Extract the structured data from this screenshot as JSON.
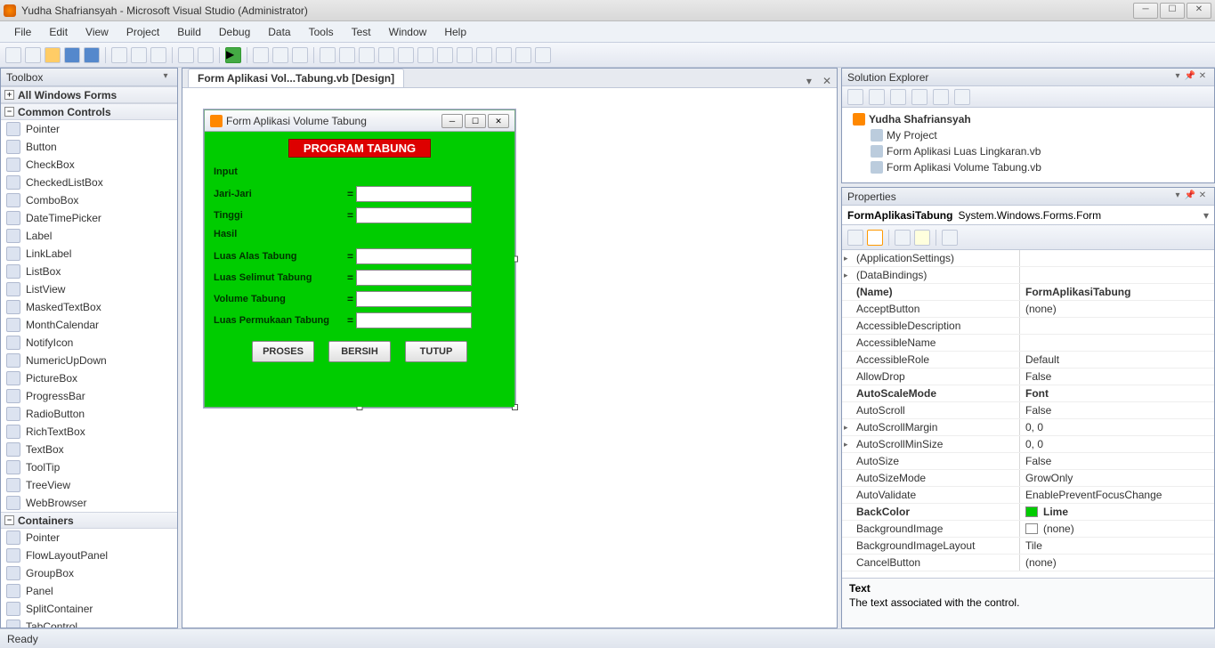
{
  "title": "Yudha Shafriansyah - Microsoft Visual Studio (Administrator)",
  "menu": [
    "File",
    "Edit",
    "View",
    "Project",
    "Build",
    "Debug",
    "Data",
    "Tools",
    "Test",
    "Window",
    "Help"
  ],
  "toolbox": {
    "title": "Toolbox",
    "groups": [
      {
        "label": "All Windows Forms",
        "items": []
      },
      {
        "label": "Common Controls",
        "items": [
          "Pointer",
          "Button",
          "CheckBox",
          "CheckedListBox",
          "ComboBox",
          "DateTimePicker",
          "Label",
          "LinkLabel",
          "ListBox",
          "ListView",
          "MaskedTextBox",
          "MonthCalendar",
          "NotifyIcon",
          "NumericUpDown",
          "PictureBox",
          "ProgressBar",
          "RadioButton",
          "RichTextBox",
          "TextBox",
          "ToolTip",
          "TreeView",
          "WebBrowser"
        ]
      },
      {
        "label": "Containers",
        "items": [
          "Pointer",
          "FlowLayoutPanel",
          "GroupBox",
          "Panel",
          "SplitContainer",
          "TabControl"
        ]
      }
    ]
  },
  "tab": "Form Aplikasi Vol...Tabung.vb [Design]",
  "form": {
    "title": "Form Aplikasi Volume Tabung",
    "program": "PROGRAM TABUNG",
    "input_hdr": "Input",
    "hasil_hdr": "Hasil",
    "rows_input": [
      {
        "label": "Jari-Jari"
      },
      {
        "label": "Tinggi"
      }
    ],
    "rows_hasil": [
      {
        "label": "Luas Alas Tabung"
      },
      {
        "label": "Luas Selimut Tabung"
      },
      {
        "label": "Volume Tabung"
      },
      {
        "label": "Luas Permukaan Tabung"
      }
    ],
    "buttons": [
      "PROSES",
      "BERSIH",
      "TUTUP"
    ]
  },
  "solution": {
    "title": "Solution Explorer",
    "root": "Yudha Shafriansyah",
    "children": [
      "My Project",
      "Form Aplikasi Luas Lingkaran.vb",
      "Form Aplikasi Volume Tabung.vb"
    ]
  },
  "props": {
    "title": "Properties",
    "selected_name": "FormAplikasiTabung",
    "selected_type": "System.Windows.Forms.Form",
    "rows": [
      {
        "k": "(ApplicationSettings)",
        "v": "",
        "exp": true
      },
      {
        "k": "(DataBindings)",
        "v": "",
        "exp": true
      },
      {
        "k": "(Name)",
        "v": "FormAplikasiTabung",
        "bold": true
      },
      {
        "k": "AcceptButton",
        "v": "(none)"
      },
      {
        "k": "AccessibleDescription",
        "v": ""
      },
      {
        "k": "AccessibleName",
        "v": ""
      },
      {
        "k": "AccessibleRole",
        "v": "Default"
      },
      {
        "k": "AllowDrop",
        "v": "False"
      },
      {
        "k": "AutoScaleMode",
        "v": "Font",
        "bold": true
      },
      {
        "k": "AutoScroll",
        "v": "False"
      },
      {
        "k": "AutoScrollMargin",
        "v": "0, 0",
        "exp": true
      },
      {
        "k": "AutoScrollMinSize",
        "v": "0, 0",
        "exp": true
      },
      {
        "k": "AutoSize",
        "v": "False"
      },
      {
        "k": "AutoSizeMode",
        "v": "GrowOnly"
      },
      {
        "k": "AutoValidate",
        "v": "EnablePreventFocusChange"
      },
      {
        "k": "BackColor",
        "v": "Lime",
        "swatch": "#00cc00",
        "bold": true
      },
      {
        "k": "BackgroundImage",
        "v": "(none)",
        "swatch": "#fff"
      },
      {
        "k": "BackgroundImageLayout",
        "v": "Tile"
      },
      {
        "k": "CancelButton",
        "v": "(none)"
      }
    ],
    "desc_title": "Text",
    "desc_body": "The text associated with the control."
  },
  "status": "Ready"
}
